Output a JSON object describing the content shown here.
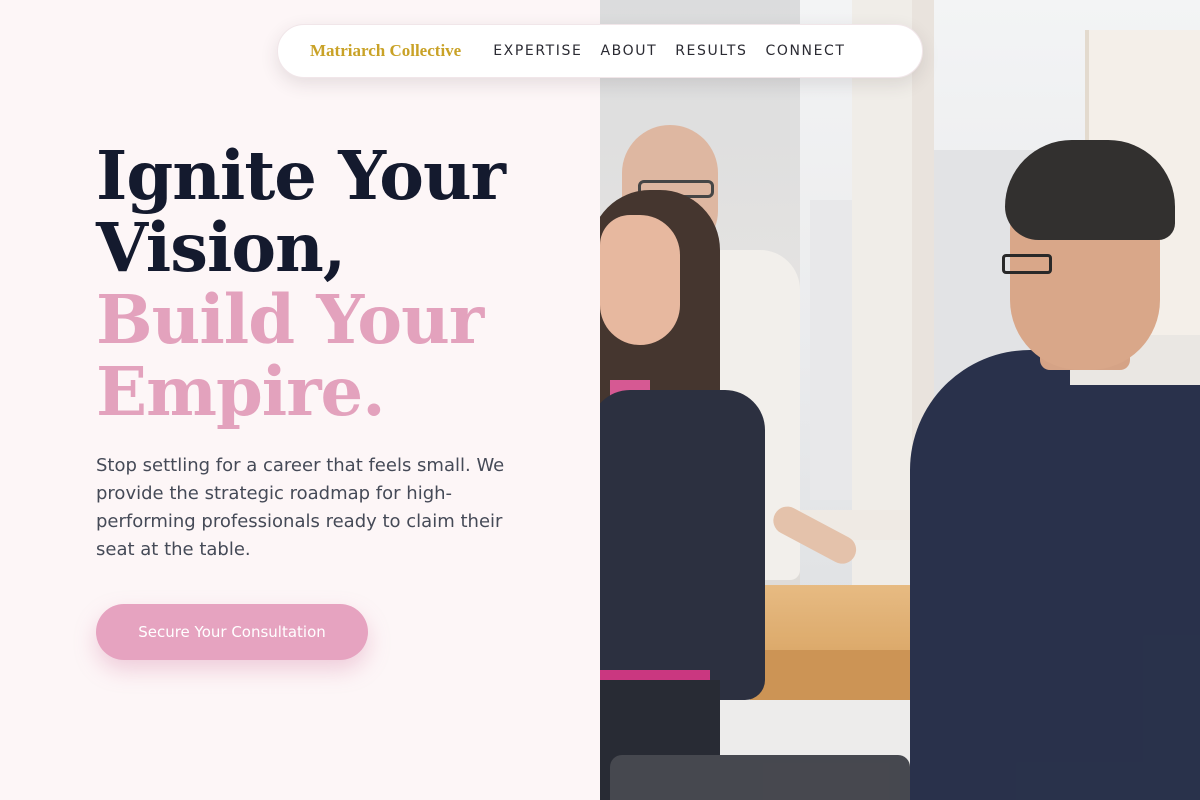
{
  "nav": {
    "brand": "Matriarch Collective",
    "links": [
      "EXPERTISE",
      "ABOUT",
      "RESULTS",
      "CONNECT"
    ]
  },
  "hero": {
    "headline_line1": "Ignite Your",
    "headline_line2": "Vision,",
    "headline_line3": "Build Your",
    "headline_line4": "Empire.",
    "subtext": "Stop settling for a career that feels small. We provide the strategic roadmap for high-performing professionals ready to claim their seat at the table.",
    "cta_label": "Secure Your Consultation"
  },
  "colors": {
    "background": "#fdf6f7",
    "brand_gold": "#c9a227",
    "headline_dark": "#141a2e",
    "accent_pink": "#e3a2bd",
    "cta_pink": "#e6a3c0"
  },
  "photo": {
    "subject": "three professionals in an office by a window"
  }
}
